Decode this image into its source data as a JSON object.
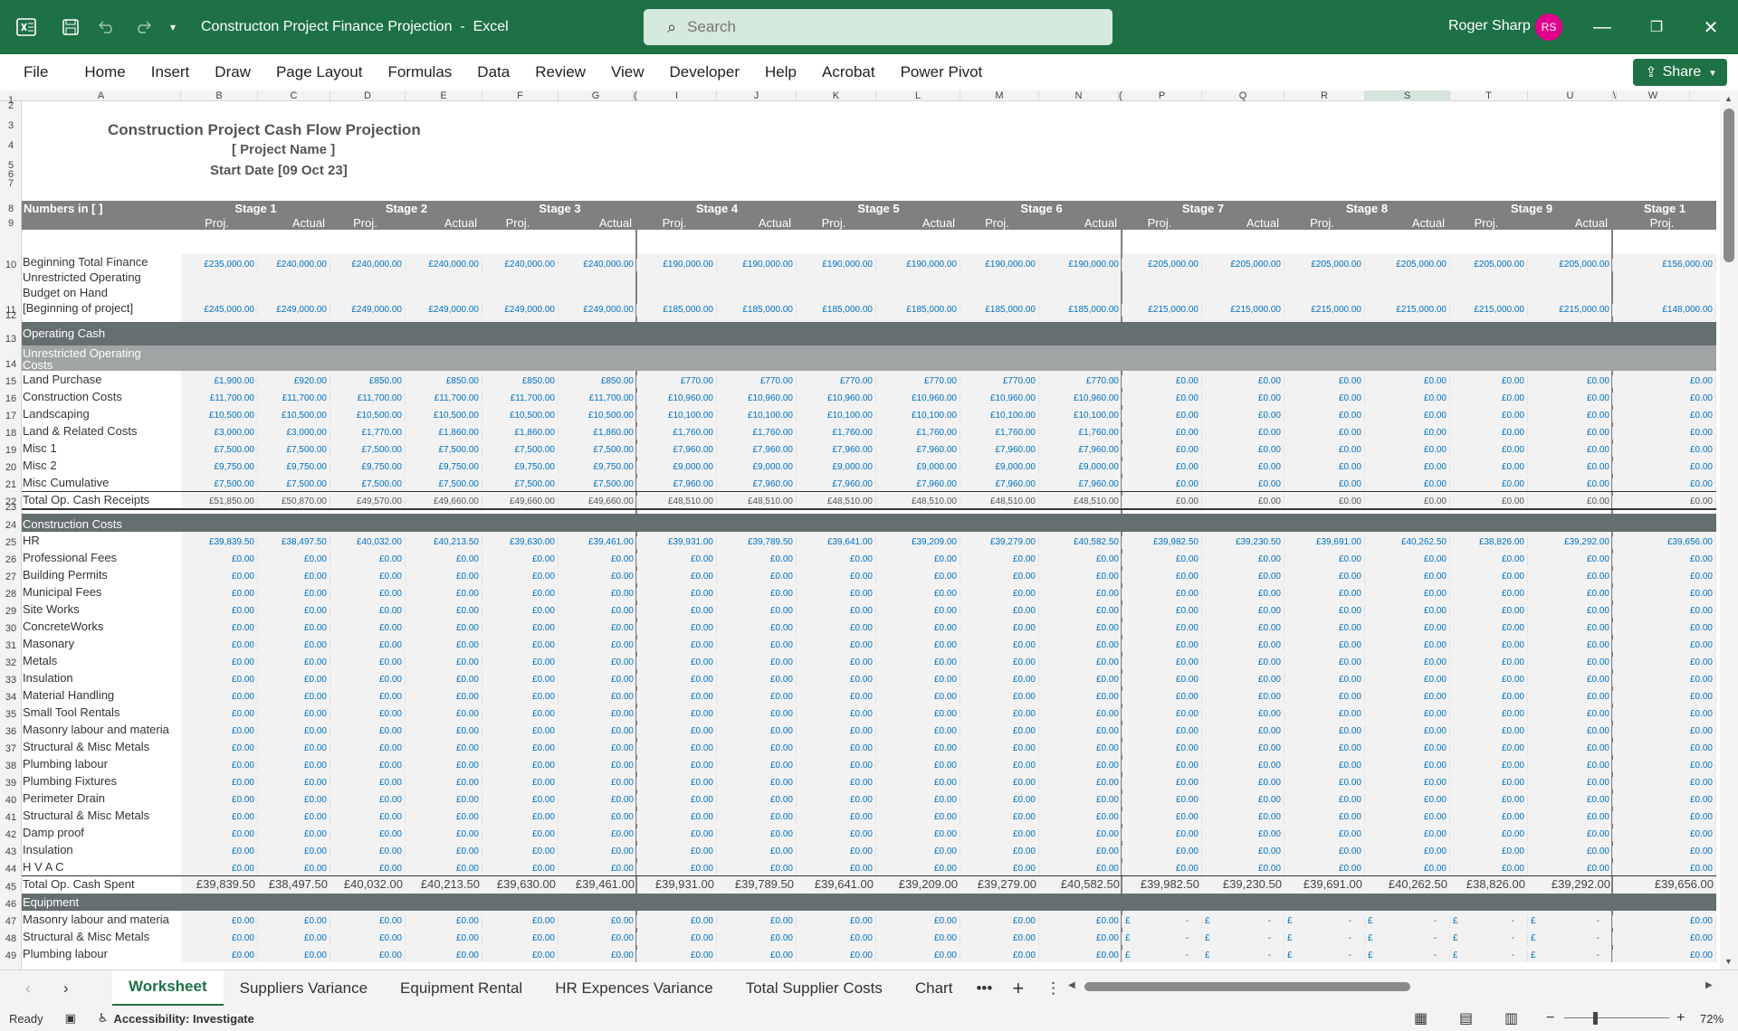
{
  "titlebar": {
    "document_title": "Constructon Project Finance Projection",
    "separator": "-",
    "app_name": "Excel",
    "search_placeholder": "Search",
    "user_name": "Roger Sharp",
    "user_initials": "RS",
    "share_label": "Share"
  },
  "ribbon_tabs": [
    "File",
    "Home",
    "Insert",
    "Draw",
    "Page Layout",
    "Formulas",
    "Data",
    "Review",
    "View",
    "Developer",
    "Help",
    "Acrobat",
    "Power Pivot"
  ],
  "column_letters": [
    "A",
    "B",
    "C",
    "D",
    "E",
    "F",
    "G",
    "(",
    "I",
    "J",
    "K",
    "L",
    "M",
    "N",
    "(",
    "P",
    "Q",
    "R",
    "S",
    "T",
    "U",
    "\\",
    "W"
  ],
  "sheet": {
    "title": "Construction Project Cash Flow Projection",
    "project_name": "[ Project Name ]",
    "start_date": "Start Date [09 Oct 23]",
    "numbers_label": "Numbers in [ ]",
    "stages": [
      "Stage 1",
      "Stage 2",
      "Stage 3",
      "Stage 4",
      "Stage 5",
      "Stage 6",
      "Stage 7",
      "Stage 8",
      "Stage 9",
      "Stage 1"
    ],
    "proj_label": "Proj.",
    "actual_label": "Actual",
    "beginning_total_finance": {
      "label": "Beginning Total Finance",
      "values": [
        "£235,000.00",
        "£240,000.00",
        "£240,000.00",
        "£240,000.00",
        "£240,000.00",
        "£240,000.00",
        "£190,000.00",
        "£190,000.00",
        "£190,000.00",
        "£190,000.00",
        "£190,000.00",
        "£190,000.00",
        "£205,000.00",
        "£205,000.00",
        "£205,000.00",
        "£205,000.00",
        "£205,000.00",
        "£205,000.00",
        "£156,000.00"
      ]
    },
    "unrestricted_budget": {
      "label_lines": [
        "Unrestricted Operating",
        "Budget on Hand",
        "[Beginning of project]"
      ],
      "values": [
        "£245,000.00",
        "£249,000.00",
        "£249,000.00",
        "£249,000.00",
        "£249,000.00",
        "£249,000.00",
        "£185,000.00",
        "£185,000.00",
        "£185,000.00",
        "£185,000.00",
        "£185,000.00",
        "£185,000.00",
        "£215,000.00",
        "£215,000.00",
        "£215,000.00",
        "£215,000.00",
        "£215,000.00",
        "£215,000.00",
        "£148,000.00"
      ]
    },
    "operating_cash_label": "Operating Cash",
    "unrestricted_costs_label_lines": [
      "Unrestricted Operating",
      "Costs"
    ],
    "operating_rows": [
      {
        "label": "Land Purchase",
        "values": [
          "£1,900.00",
          "£920.00",
          "£850.00",
          "£850.00",
          "£850.00",
          "£850.00",
          "£770.00",
          "£770.00",
          "£770.00",
          "£770.00",
          "£770.00",
          "£770.00",
          "£0.00",
          "£0.00",
          "£0.00",
          "£0.00",
          "£0.00",
          "£0.00",
          "£0.00"
        ]
      },
      {
        "label": "Construction Costs",
        "values": [
          "£11,700.00",
          "£11,700.00",
          "£11,700.00",
          "£11,700.00",
          "£11,700.00",
          "£11,700.00",
          "£10,960.00",
          "£10,960.00",
          "£10,960.00",
          "£10,960.00",
          "£10,960.00",
          "£10,960.00",
          "£0.00",
          "£0.00",
          "£0.00",
          "£0.00",
          "£0.00",
          "£0.00",
          "£0.00"
        ]
      },
      {
        "label": "Landscaping",
        "values": [
          "£10,500.00",
          "£10,500.00",
          "£10,500.00",
          "£10,500.00",
          "£10,500.00",
          "£10,500.00",
          "£10,100.00",
          "£10,100.00",
          "£10,100.00",
          "£10,100.00",
          "£10,100.00",
          "£10,100.00",
          "£0.00",
          "£0.00",
          "£0.00",
          "£0.00",
          "£0.00",
          "£0.00",
          "£0.00"
        ]
      },
      {
        "label": "Land & Related Costs",
        "values": [
          "£3,000.00",
          "£3,000.00",
          "£1,770.00",
          "£1,860.00",
          "£1,860.00",
          "£1,860.00",
          "£1,760.00",
          "£1,760.00",
          "£1,760.00",
          "£1,760.00",
          "£1,760.00",
          "£1,760.00",
          "£0.00",
          "£0.00",
          "£0.00",
          "£0.00",
          "£0.00",
          "£0.00",
          "£0.00"
        ]
      },
      {
        "label": "Misc 1",
        "values": [
          "£7,500.00",
          "£7,500.00",
          "£7,500.00",
          "£7,500.00",
          "£7,500.00",
          "£7,500.00",
          "£7,960.00",
          "£7,960.00",
          "£7,960.00",
          "£7,960.00",
          "£7,960.00",
          "£7,960.00",
          "£0.00",
          "£0.00",
          "£0.00",
          "£0.00",
          "£0.00",
          "£0.00",
          "£0.00"
        ]
      },
      {
        "label": "Misc 2",
        "values": [
          "£9,750.00",
          "£9,750.00",
          "£9,750.00",
          "£9,750.00",
          "£9,750.00",
          "£9,750.00",
          "£9,000.00",
          "£9,000.00",
          "£9,000.00",
          "£9,000.00",
          "£9,000.00",
          "£9,000.00",
          "£0.00",
          "£0.00",
          "£0.00",
          "£0.00",
          "£0.00",
          "£0.00",
          "£0.00"
        ]
      },
      {
        "label": "Misc Cumulative",
        "values": [
          "£7,500.00",
          "£7,500.00",
          "£7,500.00",
          "£7,500.00",
          "£7,500.00",
          "£7,500.00",
          "£7,960.00",
          "£7,960.00",
          "£7,960.00",
          "£7,960.00",
          "£7,960.00",
          "£7,960.00",
          "£0.00",
          "£0.00",
          "£0.00",
          "£0.00",
          "£0.00",
          "£0.00",
          "£0.00"
        ]
      }
    ],
    "total_receipts": {
      "label": "Total Op. Cash Receipts",
      "values": [
        "£51,850.00",
        "£50,870.00",
        "£49,570.00",
        "£49,660.00",
        "£49,660.00",
        "£49,660.00",
        "£48,510.00",
        "£48,510.00",
        "£48,510.00",
        "£48,510.00",
        "£48,510.00",
        "£48,510.00",
        "£0.00",
        "£0.00",
        "£0.00",
        "£0.00",
        "£0.00",
        "£0.00",
        "£0.00"
      ]
    },
    "construction_costs_label": "Construction Costs",
    "hr_row": {
      "label": "HR",
      "values": [
        "£39,839.50",
        "£38,497.50",
        "£40,032.00",
        "£40,213.50",
        "£39,630.00",
        "£39,461.00",
        "£39,931.00",
        "£39,789.50",
        "£39,641.00",
        "£39,209.00",
        "£39,279.00",
        "£40,582.50",
        "£39,982.50",
        "£39,230.50",
        "£39,691.00",
        "£40,262.50",
        "£38,826.00",
        "£39,292.00",
        "£39,656.00"
      ]
    },
    "zero_rows": [
      "Professional Fees",
      "Building Permits",
      "Municipal Fees",
      "Site Works",
      "ConcreteWorks",
      "Masonary",
      "Metals",
      "Insulation",
      "Material Handling",
      "Small Tool Rentals",
      "Masonry labour and materia",
      "Structural & Misc Metals",
      "Plumbing labour",
      "Plumbing Fixtures",
      "Perimeter Drain",
      "Structural & Misc Metals",
      "Damp proof",
      "Insulation",
      "H V A C"
    ],
    "zero_value": "£0.00",
    "total_spent": {
      "label": "Total Op. Cash Spent",
      "values": [
        "£39,839.50",
        "£38,497.50",
        "£40,032.00",
        "£40,213.50",
        "£39,630.00",
        "£39,461.00",
        "£39,931.00",
        "£39,789.50",
        "£39,641.00",
        "£39,209.00",
        "£39,279.00",
        "£40,582.50",
        "£39,982.50",
        "£39,230.50",
        "£39,691.00",
        "£40,262.50",
        "£38,826.00",
        "£39,292.00",
        "£39,656.00"
      ]
    },
    "equipment_label": "Equipment",
    "equipment_rows": [
      "Masonry labour and materia",
      "Structural & Misc Metals",
      "Plumbing labour"
    ],
    "currency_symbol": "£",
    "dash": "-"
  },
  "sheet_tabs": [
    "Worksheet",
    "Suppliers Variance",
    "Equipment Rental",
    "HR Expences Variance",
    "Total Supplier Costs",
    "Chart"
  ],
  "status": {
    "ready": "Ready",
    "accessibility": "Accessibility: Investigate",
    "zoom": "72%"
  },
  "colors": {
    "excel_green": "#1e7145",
    "number_blue": "#0070c0",
    "header_grey": "#808080",
    "section_dark": "#666f70",
    "section_mid": "#a0a4a5"
  }
}
